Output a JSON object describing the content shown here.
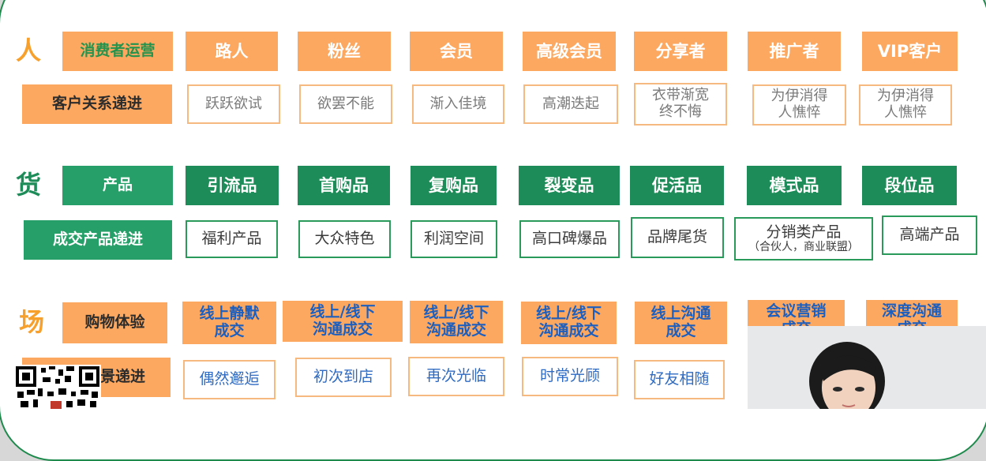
{
  "rows": {
    "people": {
      "label": "人",
      "header": "消费者运营",
      "items": [
        "路人",
        "粉丝",
        "会员",
        "高级会员",
        "分享者",
        "推广者",
        "VIP客户"
      ],
      "sub_header": "客户关系递进",
      "sub_items": [
        "跃跃欲试",
        "欲罢不能",
        "渐入佳境",
        "高潮迭起",
        "衣带渐宽\n终不悔",
        "为伊消得\n人憔悴",
        "为伊消得\n人憔悴"
      ]
    },
    "goods": {
      "label": "货",
      "header": "产品",
      "items": [
        "引流品",
        "首购品",
        "复购品",
        "裂变品",
        "促活品",
        "模式品",
        "段位品"
      ],
      "sub_header": "成交产品递进",
      "sub_items": [
        "福利产品",
        "大众特色",
        "利润空间",
        "高口碑爆品",
        "品牌尾货",
        "分销类产品",
        "高端产品"
      ],
      "sub_note": "（合伙人，商业联盟）"
    },
    "place": {
      "label": "场",
      "header": "购物体验",
      "items": [
        "线上静默\n成交",
        "线上/线下\n沟通成交",
        "线上/线下\n沟通成交",
        "线上/线下\n沟通成交",
        "线上沟通\n成交",
        "会议营销\n成交",
        "深度沟通\n成交"
      ],
      "sub_header": "景递进",
      "sub_items": [
        "偶然邂逅",
        "初次到店",
        "再次光临",
        "时常光顾",
        "好友相随"
      ]
    }
  },
  "colors": {
    "orange": "#fca860",
    "green": "#1e8c58",
    "border_green": "#1e8a4c",
    "blue_text": "#1d5fbf"
  }
}
